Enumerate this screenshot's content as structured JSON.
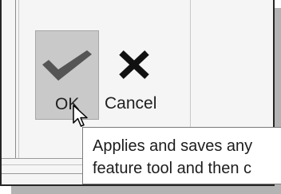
{
  "toolbar": {
    "ok_label": "OK",
    "cancel_label": "Cancel"
  },
  "tooltip": {
    "line1": "Applies and saves any",
    "line2": "feature tool and then c"
  },
  "icons": {
    "ok": "check-icon",
    "cancel": "close-icon",
    "pointer": "cursor-icon"
  },
  "colors": {
    "check": "#555555",
    "close": "#111111",
    "ok_button_bg": "#c9c9c9"
  }
}
